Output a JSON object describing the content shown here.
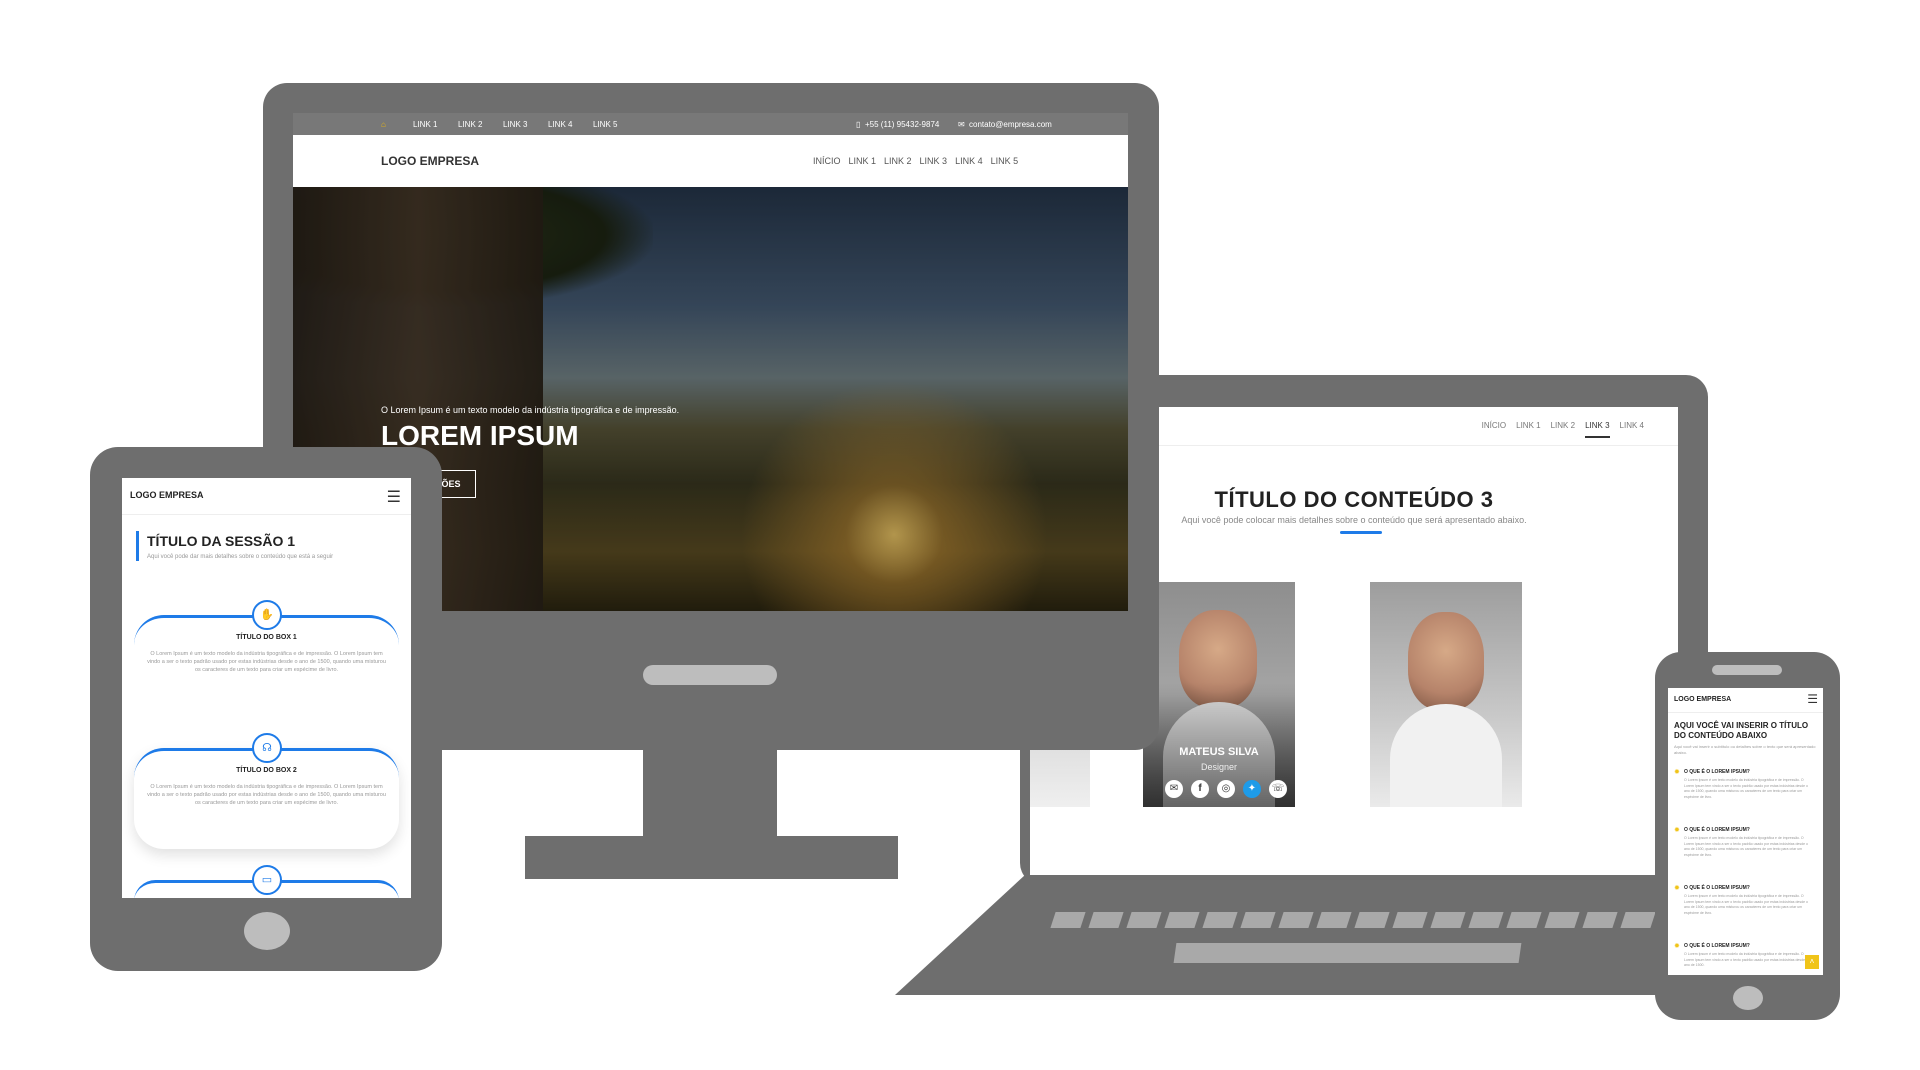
{
  "desktop": {
    "topbar": {
      "links": [
        "LINK 1",
        "LINK 2",
        "LINK 3",
        "LINK 4",
        "LINK 5"
      ],
      "phone": "+55 (11) 95432-9874",
      "email": "contato@empresa.com"
    },
    "nav": {
      "logo": "LOGO EMPRESA",
      "links": [
        "INÍCIO",
        "LINK 1",
        "LINK 2",
        "LINK 3",
        "LINK 4",
        "LINK 5"
      ]
    },
    "hero": {
      "subtitle": "O Lorem Ipsum é um texto modelo da indústria tipográfica e de impressão.",
      "title": "LOREM IPSUM",
      "button": "MAIS INFORMAÇÕES"
    }
  },
  "laptop": {
    "nav": {
      "links": [
        "INÍCIO",
        "LINK 1",
        "LINK 2",
        "LINK 3",
        "LINK 4"
      ],
      "active_index": 3
    },
    "section": {
      "title": "TÍTULO DO CONTEÚDO 3",
      "subtitle": "Aqui você pode colocar mais detalhes sobre o conteúdo que será apresentado abaixo."
    },
    "team": [
      {
        "name": "MATEUS SILVA",
        "role": "Designer"
      }
    ],
    "social_icons": [
      "envelope-icon",
      "facebook-icon",
      "instagram-icon",
      "twitter-icon",
      "whatsapp-icon"
    ],
    "colors": {
      "accent": "#1e7be8"
    }
  },
  "tablet": {
    "logo": "LOGO EMPRESA",
    "section": {
      "title": "TÍTULO DA SESSÃO 1",
      "subtitle": "Aqui você pode dar mais detalhes sobre o conteúdo que está a seguir"
    },
    "boxes": [
      {
        "icon": "handshake-icon",
        "title": "TÍTULO DO BOX 1",
        "text": "O Lorem Ipsum é um texto modelo da indústria tipográfica e de impressão. O Lorem Ipsum tem vindo a ser o texto padrão usado por estas indústrias desde o ano de 1500, quando uma misturou os caracteres de um texto para criar um espécime de livro."
      },
      {
        "icon": "headset-icon",
        "title": "TÍTULO DO BOX 2",
        "text": "O Lorem Ipsum é um texto modelo da indústria tipográfica e de impressão. O Lorem Ipsum tem vindo a ser o texto padrão usado por estas indústrias desde o ano de 1500, quando uma misturou os caracteres de um texto para criar um espécime de livro."
      },
      {
        "icon": "laptop-icon",
        "title": "",
        "text": ""
      }
    ]
  },
  "phone": {
    "logo": "LOGO EMPRESA",
    "section": {
      "title": "AQUI VOCÊ VAI INSERIR O TÍTULO DO CONTEÚDO ABAIXO",
      "subtitle": "Aqui você vai inserir o subtítulo ou detalhes sobre o texto que será apresentado abaixo."
    },
    "faq": [
      {
        "q": "O QUE É O LOREM IPSUM?",
        "a": "O Lorem Ipsum é um texto modelo da indústria tipográfica e de impressão. O Lorem Ipsum tem vindo a ser o texto padrão usado por estas indústrias desde o ano de 1500, quando uma misturou os caracteres de um texto para criar um espécime de livro."
      },
      {
        "q": "O QUE É O LOREM IPSUM?",
        "a": "O Lorem Ipsum é um texto modelo da indústria tipográfica e de impressão. O Lorem Ipsum tem vindo a ser o texto padrão usado por estas indústrias desde o ano de 1500, quando uma misturou os caracteres de um texto para criar um espécime de livro."
      },
      {
        "q": "O QUE É O LOREM IPSUM?",
        "a": "O Lorem Ipsum é um texto modelo da indústria tipográfica e de impressão. O Lorem Ipsum tem vindo a ser o texto padrão usado por estas indústrias desde o ano de 1500, quando uma misturou os caracteres de um texto para criar um espécime de livro."
      },
      {
        "q": "O QUE É O LOREM IPSUM?",
        "a": "O Lorem Ipsum é um texto modelo da indústria tipográfica e de impressão. O Lorem Ipsum tem vindo a ser o texto padrão usado por estas indústrias desde o ano de 1500."
      }
    ],
    "colors": {
      "accent": "#f0c419"
    }
  }
}
